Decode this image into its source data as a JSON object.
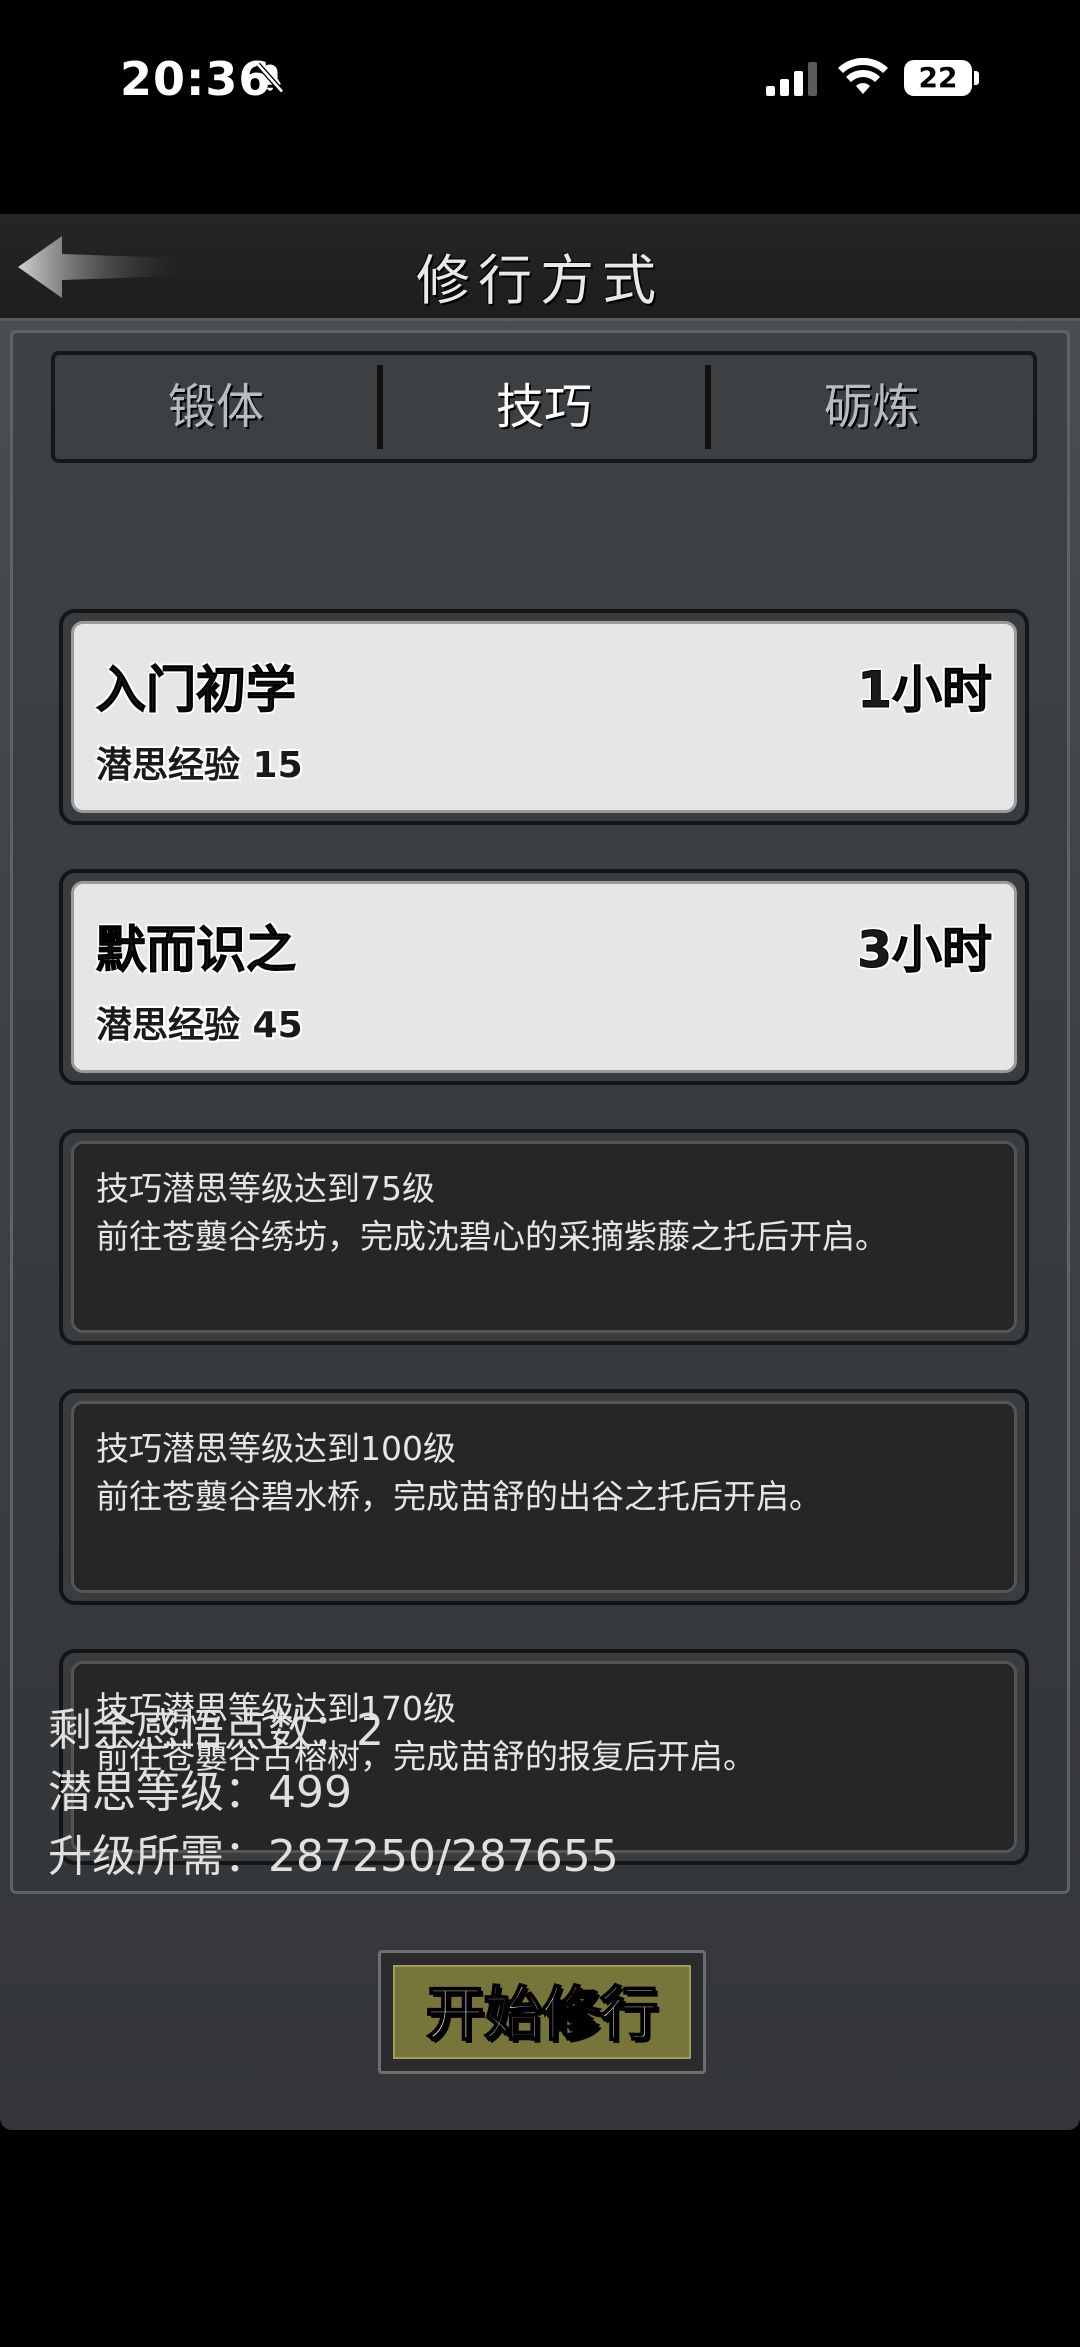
{
  "status_bar": {
    "time": "20:36",
    "battery": "22"
  },
  "header": {
    "title": "修行方式"
  },
  "tabs": [
    {
      "label": "锻体",
      "active": false
    },
    {
      "label": "技巧",
      "active": true
    },
    {
      "label": "砺炼",
      "active": false
    }
  ],
  "training_options": [
    {
      "name": "入门初学",
      "duration": "1小时",
      "exp": "潜思经验 15"
    },
    {
      "name": "默而识之",
      "duration": "3小时",
      "exp": "潜思经验 45"
    }
  ],
  "locked_options": [
    {
      "requirement": "技巧潜思等级达到75级",
      "unlock": "前往苍蘡谷绣坊，完成沈碧心的采摘紫藤之托后开启。"
    },
    {
      "requirement": "技巧潜思等级达到100级",
      "unlock": "前往苍蘡谷碧水桥，完成苗舒的出谷之托后开启。"
    },
    {
      "requirement": "技巧潜思等级达到170级",
      "unlock": "前往苍蘡谷古榕树，完成苗舒的报复后开启。"
    }
  ],
  "stats": {
    "remaining_points": "剩余感悟点数：2",
    "level": "潜思等级：499",
    "upgrade_required": "升级所需：287250/287655"
  },
  "start_button": "开始修行",
  "colors": {
    "panel": "#3f4347",
    "button_face": "#78753a",
    "card_open": "#e6e6e6",
    "card_locked": "#262626"
  }
}
